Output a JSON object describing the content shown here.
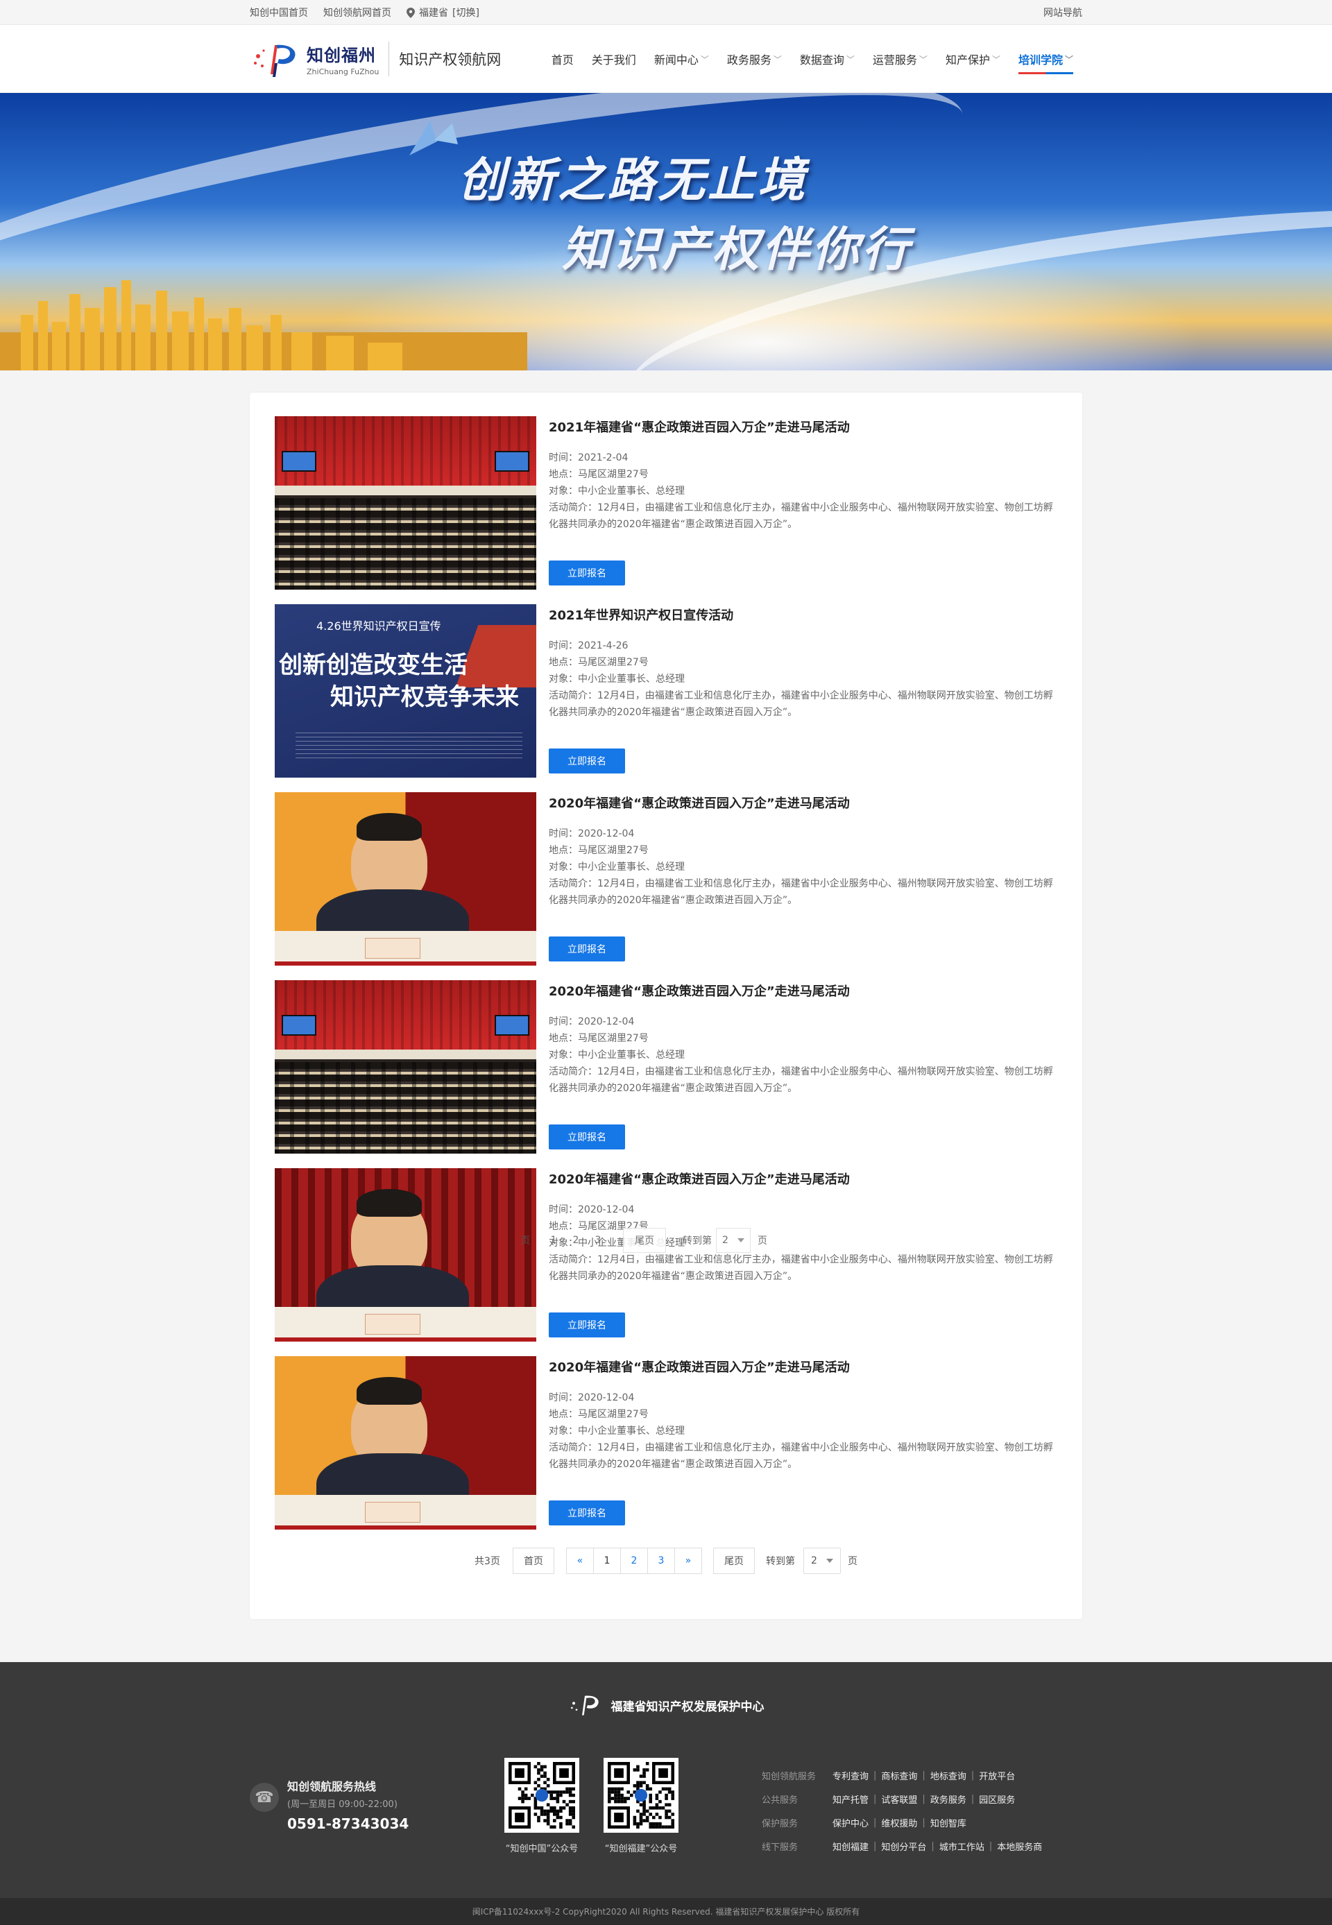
{
  "topbar": {
    "links": [
      "知创中国首页",
      "知创领航网首页"
    ],
    "location": "福建省",
    "switch": "[切换]",
    "site_nav": "网站导航"
  },
  "header": {
    "brand_cn": "知创福州",
    "brand_en": "ZhiChuang FuZhou",
    "site_name": "知识产权领航网",
    "nav": [
      {
        "label": "首页",
        "dropdown": false
      },
      {
        "label": "关于我们",
        "dropdown": false
      },
      {
        "label": "新闻中心",
        "dropdown": true
      },
      {
        "label": "政务服务",
        "dropdown": true
      },
      {
        "label": "数据查询",
        "dropdown": true
      },
      {
        "label": "运营服务",
        "dropdown": true
      },
      {
        "label": "知产保护",
        "dropdown": true
      },
      {
        "label": "培训学院",
        "dropdown": true,
        "active": true
      }
    ]
  },
  "banner": {
    "line1": "创新之路无止境",
    "line2": "知识产权伴你行"
  },
  "events": [
    {
      "title": "2021年福建省“惠企政策进百园入万企”走进马尾活动",
      "time": "时间：2021-2-04",
      "place": "地点：马尾区湖里27号",
      "target": "对象：中小企业董事长、总经理",
      "intro": "活动简介：12月4日，由福建省工业和信息化厅主办，福建省中小企业服务中心、福州物联网开放实验室、物创工坊孵化器共同承办的2020年福建省“惠企政策进百园入万企”。",
      "button": "立即报名",
      "image": "conference-hall"
    },
    {
      "title": "2021年世界知识产权日宣传活动",
      "time": "时间：2021-4-26",
      "place": "地点：马尾区湖里27号",
      "target": "对象：中小企业董事长、总经理",
      "intro": "活动简介：12月4日，由福建省工业和信息化厅主办，福建省中小企业服务中心、福州物联网开放实验室、物创工坊孵化器共同承办的2020年福建省“惠企政策进百园入万企”。",
      "button": "立即报名",
      "image": "poster",
      "poster": {
        "tag": "4.26世界知识产权日宣传",
        "line1": "创新创造改变生活",
        "line2": "知识产权竞争未来"
      }
    },
    {
      "title": "2020年福建省“惠企政策进百园入万企”走进马尾活动",
      "time": "时间：2020-12-04",
      "place": "地点：马尾区湖里27号",
      "target": "对象：中小企业董事长、总经理",
      "intro": "活动简介：12月4日，由福建省工业和信息化厅主办，福建省中小企业服务中心、福州物联网开放实验室、物创工坊孵化器共同承办的2020年福建省“惠企政策进百园入万企”。",
      "button": "立即报名",
      "image": "speaker-orange"
    },
    {
      "title": "2020年福建省“惠企政策进百园入万企”走进马尾活动",
      "time": "时间：2020-12-04",
      "place": "地点：马尾区湖里27号",
      "target": "对象：中小企业董事长、总经理",
      "intro": "活动简介：12月4日，由福建省工业和信息化厅主办，福建省中小企业服务中心、福州物联网开放实验室、物创工坊孵化器共同承办的2020年福建省“惠企政策进百园入万企”。",
      "button": "立即报名",
      "image": "conference-hall"
    },
    {
      "title": "2020年福建省“惠企政策进百园入万企”走进马尾活动",
      "time": "时间：2020-12-04",
      "place": "地点：马尾区湖里27号",
      "target": "对象：中小企业董事长、总经理",
      "intro": "活动简介：12月4日，由福建省工业和信息化厅主办，福建省中小企业服务中心、福州物联网开放实验室、物创工坊孵化器共同承办的2020年福建省“惠企政策进百园入万企”。",
      "button": "立即报名",
      "image": "speaker-red"
    },
    {
      "title": "2020年福建省“惠企政策进百园入万企”走进马尾活动",
      "time": "时间：2020-12-04",
      "place": "地点：马尾区湖里27号",
      "target": "对象：中小企业董事长、总经理",
      "intro": "活动简介：12月4日，由福建省工业和信息化厅主办，福建省中小企业服务中心、福州物联网开放实验室、物创工坊孵化器共同承办的2020年福建省“惠企政策进百园入万企”。",
      "button": "立即报名",
      "image": "speaker-orange"
    }
  ],
  "pager": {
    "total": "共3页",
    "home": "首页",
    "prev": "«",
    "pages": [
      "1",
      "2",
      "3"
    ],
    "next": "»",
    "last": "尾页",
    "jump_label": "转到第",
    "jump_value": "2",
    "unit": "页"
  },
  "ghost_pager": {
    "pages": [
      "1",
      "2",
      "3"
    ],
    "last": "尾页",
    "jump_label": "转到第",
    "jump_value": "2",
    "unit": "页"
  },
  "footer": {
    "org": "福建省知识产权发展保护中心",
    "hotline_title": "知创领航服务热线",
    "hotline_hours": "(周一至周日 09:00-22:00)",
    "hotline_number": "0591-87343034",
    "qr": [
      {
        "caption": "“知创中国”公众号"
      },
      {
        "caption": "“知创福建”公众号"
      }
    ],
    "links": [
      {
        "label": "知创领航服务",
        "items": [
          "专利查询",
          "商标查询",
          "地标查询",
          "开放平台"
        ]
      },
      {
        "label": "公共服务",
        "items": [
          "知产托管",
          "试客联盟",
          "政务服务",
          "园区服务"
        ]
      },
      {
        "label": "保护服务",
        "items": [
          "保护中心",
          "维权援助",
          "知创智库"
        ]
      },
      {
        "label": "线下服务",
        "items": [
          "知创福建",
          "知创分平台",
          "城市工作站",
          "本地服务商"
        ]
      }
    ],
    "copyright": "闽ICP备11024xxx号-2  CopyRight2020  All Rights Reserved.  福建省知识产权发展保护中心  版权所有"
  },
  "colors": {
    "accent": "#1677e6",
    "active_nav": "#0b6fd6",
    "footer_bg": "#3a3a3a"
  }
}
